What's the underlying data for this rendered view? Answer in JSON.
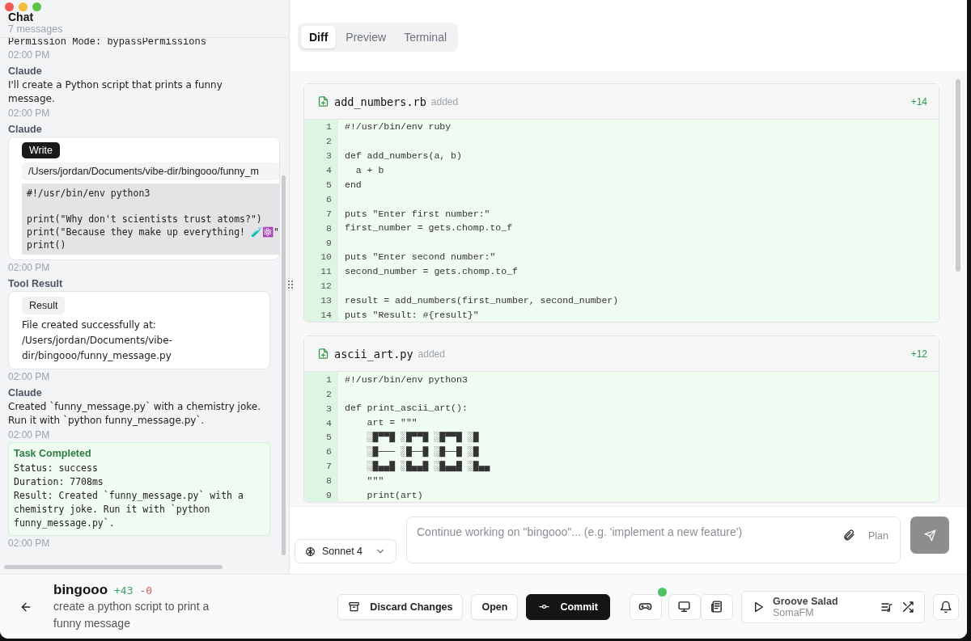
{
  "chat": {
    "title": "Chat",
    "subtitle": "7 messages",
    "messages": [
      {
        "kind": "system",
        "text": "Permission Mode: bypassPermissions",
        "time": "02:00 PM"
      },
      {
        "kind": "text",
        "author": "Claude",
        "text": "I'll create a Python script that prints a funny message.",
        "time": "02:00 PM"
      },
      {
        "kind": "tool",
        "author": "Claude",
        "badge": "Write",
        "path": "/Users/jordan/Documents/vibe-dir/bingooo/funny_m",
        "code": "#!/usr/bin/env python3\n\nprint(\"Why don't scientists trust atoms?\")\nprint(\"Because they make up everything! 🧪⚛️\"\nprint()",
        "time": "02:00 PM"
      },
      {
        "kind": "result",
        "author": "Tool Result",
        "badge": "Result",
        "text": "File created successfully at: /Users/jordan/Documents/vibe-dir/bingooo/funny_message.py",
        "time": "02:00 PM"
      },
      {
        "kind": "text",
        "author": "Claude",
        "text": "Created `funny_message.py` with a chemistry joke. Run it with `python funny_message.py`.",
        "time": "02:00 PM"
      },
      {
        "kind": "task",
        "title": "Task Completed",
        "lines": [
          "Status: success",
          "Duration: 7708ms",
          "Result: Created `funny_message.py` with a chemistry joke. Run it with `python funny_message.py`."
        ],
        "time": "02:00 PM"
      }
    ]
  },
  "tabs": [
    {
      "label": "Diff",
      "selected": true
    },
    {
      "label": "Preview",
      "selected": false
    },
    {
      "label": "Terminal",
      "selected": false
    }
  ],
  "files": [
    {
      "name": "add_numbers.rb",
      "status": "added",
      "count": "+14",
      "lines": [
        {
          "n": "1",
          "code": "#!/usr/bin/env ruby"
        },
        {
          "n": "2"
        },
        {
          "n": "3",
          "code": "def add_numbers(a, b)"
        },
        {
          "n": "4",
          "code": "  a + b"
        },
        {
          "n": "5",
          "code": "end"
        },
        {
          "n": "6"
        },
        {
          "n": "7",
          "code": "puts \"Enter first number:\""
        },
        {
          "n": "8",
          "code": "first_number = gets.chomp.to_f"
        },
        {
          "n": "9"
        },
        {
          "n": "10",
          "code": "puts \"Enter second number:\""
        },
        {
          "n": "11",
          "code": "second_number = gets.chomp.to_f"
        },
        {
          "n": "12"
        },
        {
          "n": "13",
          "code": "result = add_numbers(first_number, second_number)"
        },
        {
          "n": "14",
          "code": "puts \"Result: #{result}\""
        }
      ]
    },
    {
      "name": "ascii_art.py",
      "status": "added",
      "count": "+12",
      "lines": [
        {
          "n": "1",
          "code": "#!/usr/bin/env python3"
        },
        {
          "n": "2"
        },
        {
          "n": "3",
          "code": "def print_ascii_art():"
        },
        {
          "n": "4",
          "code": "    art = \"\"\""
        },
        {
          "n": "5",
          "code": "    ░█▀▀█ ░█▀▀█ ░█▀▀█ ░█"
        },
        {
          "n": "6",
          "code": "    ░█─── ░█──█ ░█──█ ░█"
        },
        {
          "n": "7",
          "code": "    ░█▄▄█ ░█▄▄█ ░█▄▄█ ░█▄▄"
        },
        {
          "n": "8",
          "code": "    \"\"\""
        },
        {
          "n": "9",
          "code": "    print(art)"
        }
      ]
    }
  ],
  "composer": {
    "model": "Sonnet 4",
    "placeholder": "Continue working on \"bingooo\"... (e.g. 'implement a new feature')",
    "mode": "Plan"
  },
  "footer": {
    "project": "bingooo",
    "added": "+43",
    "removed": "-0",
    "description": "create a python script to print a funny message",
    "buttons": [
      {
        "kind": "discard",
        "label": "Discard Changes"
      },
      {
        "kind": "open",
        "label": "Open"
      },
      {
        "kind": "commit",
        "label": "Commit"
      }
    ],
    "tools": [
      {
        "kind": "gamepad",
        "notification": true
      },
      {
        "kind": "monitor",
        "notification": false
      },
      {
        "kind": "news",
        "notification": false
      }
    ],
    "player": {
      "title": "Groove Salad",
      "station": "SomaFM"
    }
  }
}
